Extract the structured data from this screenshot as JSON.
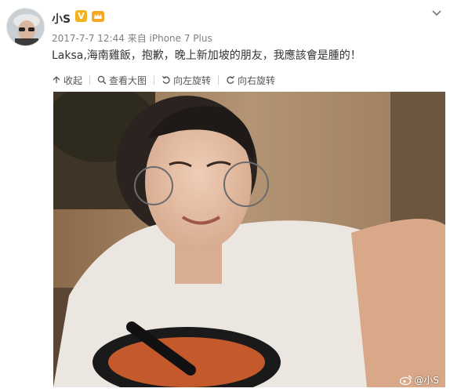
{
  "user": {
    "name": "小S",
    "verified_badge": "V"
  },
  "post": {
    "date": "2017-7-7 12:44",
    "source": "来自 iPhone 7 Plus",
    "text": "Laksa,海南雞飯，抱歉，晚上新加坡的朋友，我應該會是腫的！"
  },
  "actions": {
    "collapse": "收起",
    "view_large": "查看大图",
    "rotate_left": "向左旋转",
    "rotate_right": "向右旋转"
  },
  "watermark": "@小S",
  "colors": {
    "badge": "#f3b31f",
    "meta": "#808080",
    "photo_wall": "#a4876a"
  },
  "icons": [
    "chevron-down-icon",
    "vip-crown-icon",
    "collapse-arrow-icon",
    "magnifier-icon",
    "rotate-left-icon",
    "rotate-right-icon",
    "weibo-logo-icon"
  ]
}
